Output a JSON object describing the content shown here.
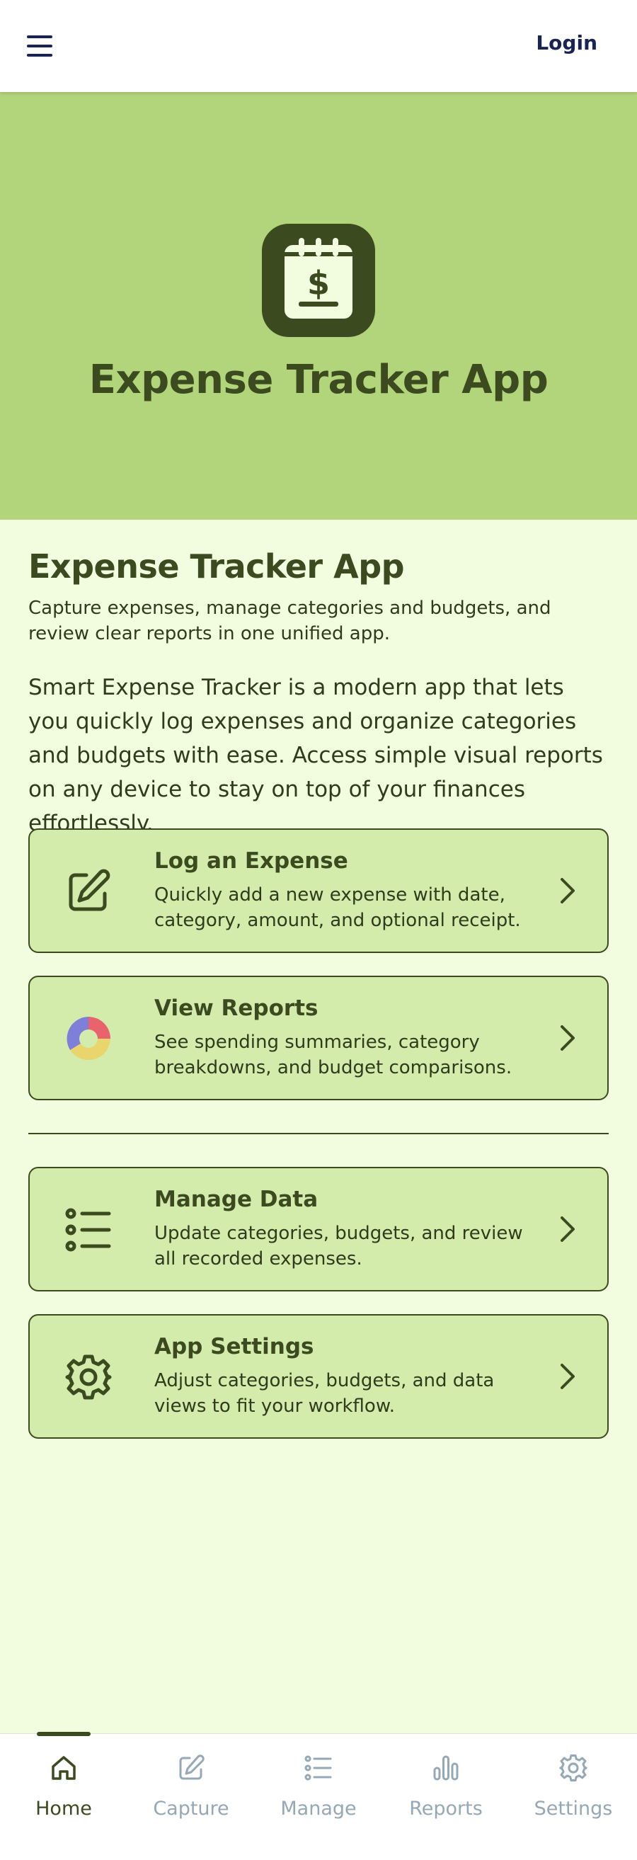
{
  "header": {
    "login_label": "Login"
  },
  "hero": {
    "title": "Expense Tracker App"
  },
  "intro": {
    "title": "Expense Tracker App",
    "subtitle": "Capture expenses, manage categories and budgets, and review clear reports in one unified app.",
    "description": "Smart Expense Tracker is a modern app that lets you quickly log expenses and organize categories and budgets with ease. Access simple visual reports on any device to stay on top of your finances effortlessly."
  },
  "cards": [
    {
      "title": "Log an Expense",
      "description": "Quickly add a new expense with date, category, amount, and optional receipt.",
      "icon": "edit-icon"
    },
    {
      "title": "View Reports",
      "description": "See spending summaries, category breakdowns, and budget comparisons.",
      "icon": "pie-chart-icon"
    },
    {
      "title": "Manage Data",
      "description": "Update categories, budgets, and review all recorded expenses.",
      "icon": "list-icon"
    },
    {
      "title": "App Settings",
      "description": "Adjust categories, budgets, and data views to fit your workflow.",
      "icon": "gear-icon"
    }
  ],
  "bottom_nav": {
    "items": [
      {
        "label": "Home",
        "icon": "home-icon",
        "active": true
      },
      {
        "label": "Capture",
        "icon": "edit-icon",
        "active": false
      },
      {
        "label": "Manage",
        "icon": "list-icon",
        "active": false
      },
      {
        "label": "Reports",
        "icon": "bar-chart-icon",
        "active": false
      },
      {
        "label": "Settings",
        "icon": "gear-icon",
        "active": false
      }
    ]
  },
  "colors": {
    "header_bg": "#ffffff",
    "hero_bg": "#b2d47a",
    "page_bg": "#f2fcdf",
    "card_bg": "#d3ecab",
    "primary_dark": "#3b4a1f",
    "login_text": "#1a2452",
    "nav_inactive": "#94a8b6",
    "pie_red": "#e8636b",
    "pie_purple": "#7d7fd8",
    "pie_yellow": "#e8d56b"
  }
}
